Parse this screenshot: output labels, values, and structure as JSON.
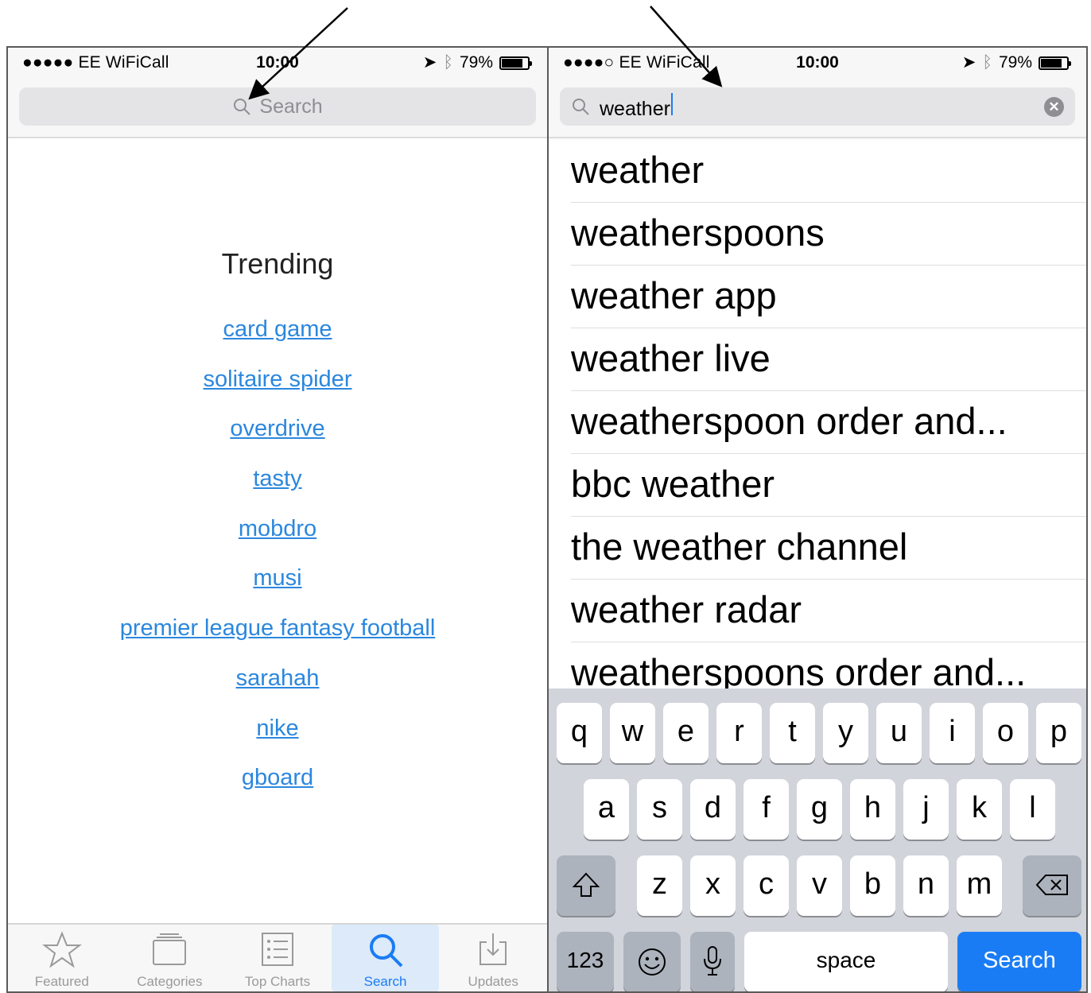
{
  "left": {
    "status": {
      "carrier": "●●●●● EE WiFiCall",
      "time": "10:00",
      "battery": "79%",
      "battery_level": 0.79
    },
    "search": {
      "placeholder": "Search"
    },
    "trending": {
      "title": "Trending",
      "items": [
        "card game",
        "solitaire spider",
        "overdrive",
        "tasty",
        "mobdro",
        "musi",
        "premier league fantasy football",
        "sarahah",
        "nike",
        "gboard"
      ]
    },
    "tabs": [
      {
        "label": "Featured",
        "icon": "star-icon"
      },
      {
        "label": "Categories",
        "icon": "categories-icon"
      },
      {
        "label": "Top Charts",
        "icon": "list-icon"
      },
      {
        "label": "Search",
        "icon": "search-icon",
        "active": true
      },
      {
        "label": "Updates",
        "icon": "download-icon"
      }
    ]
  },
  "right": {
    "status": {
      "carrier": "●●●●○ EE WiFiCall",
      "time": "10:00",
      "battery": "79%",
      "battery_level": 0.79
    },
    "search": {
      "value": "weather"
    },
    "suggestions": [
      "weather",
      "weatherspoons",
      "weather app",
      "weather live",
      "weatherspoon order and...",
      "bbc weather",
      "the weather channel",
      "weather radar",
      "weatherspoons order and..."
    ],
    "keyboard": {
      "row1": [
        "q",
        "w",
        "e",
        "r",
        "t",
        "y",
        "u",
        "i",
        "o",
        "p"
      ],
      "row2": [
        "a",
        "s",
        "d",
        "f",
        "g",
        "h",
        "j",
        "k",
        "l"
      ],
      "row3": [
        "z",
        "x",
        "c",
        "v",
        "b",
        "n",
        "m"
      ],
      "numbers_label": "123",
      "space_label": "space",
      "search_label": "Search"
    }
  },
  "colors": {
    "link": "#2b87de",
    "accent": "#1a7cf5",
    "keyboard_bg": "#d1d4da"
  }
}
